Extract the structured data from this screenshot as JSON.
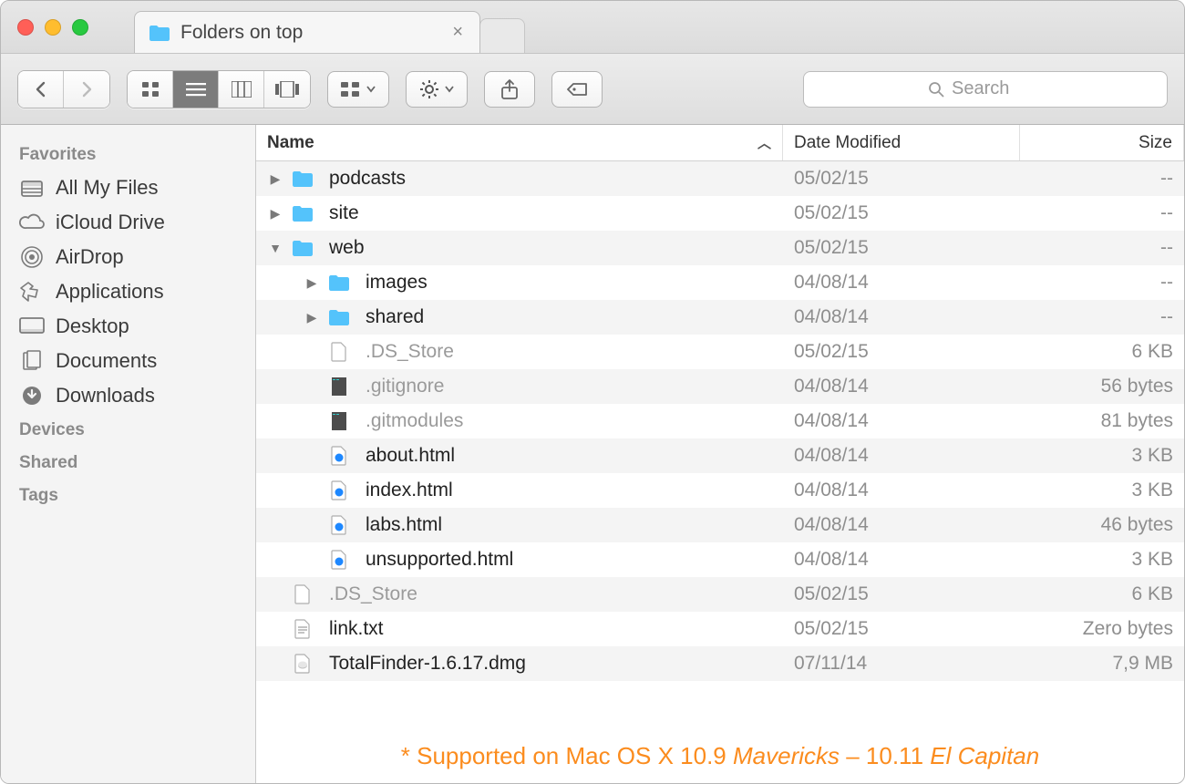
{
  "window": {
    "tab_title": "Folders on top"
  },
  "search": {
    "placeholder": "Search"
  },
  "sidebar": {
    "sections": [
      {
        "title": "Favorites",
        "items": [
          {
            "label": "All My Files",
            "icon": "all-my-files"
          },
          {
            "label": "iCloud Drive",
            "icon": "cloud"
          },
          {
            "label": "AirDrop",
            "icon": "airdrop"
          },
          {
            "label": "Applications",
            "icon": "applications"
          },
          {
            "label": "Desktop",
            "icon": "desktop"
          },
          {
            "label": "Documents",
            "icon": "documents"
          },
          {
            "label": "Downloads",
            "icon": "downloads"
          }
        ]
      },
      {
        "title": "Devices",
        "items": []
      },
      {
        "title": "Shared",
        "items": []
      },
      {
        "title": "Tags",
        "items": []
      }
    ]
  },
  "columns": {
    "name": "Name",
    "date": "Date Modified",
    "size": "Size"
  },
  "rows": [
    {
      "indent": 0,
      "disclosure": "right",
      "icon": "folder",
      "name": "podcasts",
      "date": "05/02/15",
      "size": "--",
      "dim": false
    },
    {
      "indent": 0,
      "disclosure": "right",
      "icon": "folder",
      "name": "site",
      "date": "05/02/15",
      "size": "--",
      "dim": false
    },
    {
      "indent": 0,
      "disclosure": "down",
      "icon": "folder",
      "name": "web",
      "date": "05/02/15",
      "size": "--",
      "dim": false
    },
    {
      "indent": 1,
      "disclosure": "right",
      "icon": "folder",
      "name": "images",
      "date": "04/08/14",
      "size": "--",
      "dim": false
    },
    {
      "indent": 1,
      "disclosure": "right",
      "icon": "folder",
      "name": "shared",
      "date": "04/08/14",
      "size": "--",
      "dim": false
    },
    {
      "indent": 1,
      "disclosure": "",
      "icon": "file",
      "name": ".DS_Store",
      "date": "05/02/15",
      "size": "6 KB",
      "dim": true
    },
    {
      "indent": 1,
      "disclosure": "",
      "icon": "darkfile",
      "name": ".gitignore",
      "date": "04/08/14",
      "size": "56 bytes",
      "dim": true
    },
    {
      "indent": 1,
      "disclosure": "",
      "icon": "darkfile",
      "name": ".gitmodules",
      "date": "04/08/14",
      "size": "81 bytes",
      "dim": true
    },
    {
      "indent": 1,
      "disclosure": "",
      "icon": "html",
      "name": "about.html",
      "date": "04/08/14",
      "size": "3 KB",
      "dim": false
    },
    {
      "indent": 1,
      "disclosure": "",
      "icon": "html",
      "name": "index.html",
      "date": "04/08/14",
      "size": "3 KB",
      "dim": false
    },
    {
      "indent": 1,
      "disclosure": "",
      "icon": "html",
      "name": "labs.html",
      "date": "04/08/14",
      "size": "46 bytes",
      "dim": false
    },
    {
      "indent": 1,
      "disclosure": "",
      "icon": "html",
      "name": "unsupported.html",
      "date": "04/08/14",
      "size": "3 KB",
      "dim": false
    },
    {
      "indent": 0,
      "disclosure": "",
      "icon": "file",
      "name": ".DS_Store",
      "date": "05/02/15",
      "size": "6 KB",
      "dim": true
    },
    {
      "indent": 0,
      "disclosure": "",
      "icon": "txt",
      "name": "link.txt",
      "date": "05/02/15",
      "size": "Zero bytes",
      "dim": false
    },
    {
      "indent": 0,
      "disclosure": "",
      "icon": "dmg",
      "name": "TotalFinder-1.6.17.dmg",
      "date": "07/11/14",
      "size": "7,9 MB",
      "dim": false
    }
  ],
  "footer": {
    "prefix": "* Supported on Mac OS X 10.9 ",
    "m1": "Mavericks",
    "mid": " – 10.11 ",
    "m2": "El Capitan"
  }
}
